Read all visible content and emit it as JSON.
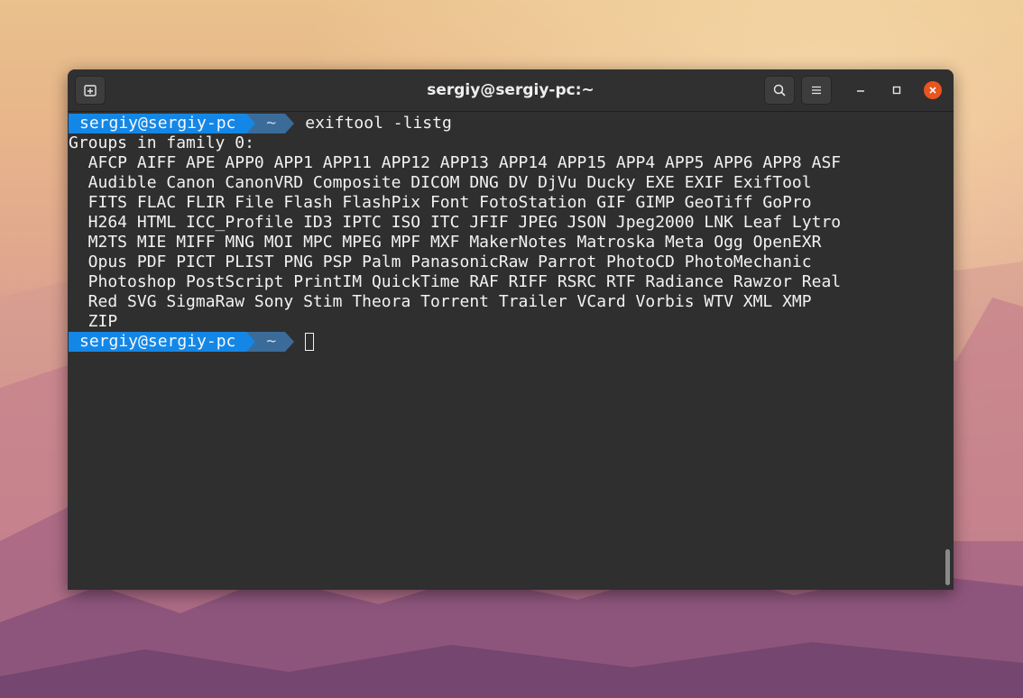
{
  "window": {
    "title": "sergiy@sergiy-pc:~",
    "new_tab_icon": "new-tab-icon",
    "search_icon": "search-icon",
    "menu_icon": "hamburger-menu-icon",
    "minimize_icon": "minimize-icon",
    "maximize_icon": "maximize-icon",
    "close_icon": "close-icon",
    "close_color": "#e9541f"
  },
  "terminal": {
    "prompt_user": "sergiy@sergiy-pc",
    "prompt_dir": "~",
    "command": "exiftool -listg",
    "header": "Groups in family 0:",
    "output_lines": [
      "  AFCP AIFF APE APP0 APP1 APP11 APP12 APP13 APP14 APP15 APP4 APP5 APP6 APP8 ASF",
      "  Audible Canon CanonVRD Composite DICOM DNG DV DjVu Ducky EXE EXIF ExifTool",
      "  FITS FLAC FLIR File Flash FlashPix Font FotoStation GIF GIMP GeoTiff GoPro",
      "  H264 HTML ICC_Profile ID3 IPTC ISO ITC JFIF JPEG JSON Jpeg2000 LNK Leaf Lytro",
      "  M2TS MIE MIFF MNG MOI MPC MPEG MPF MXF MakerNotes Matroska Meta Ogg OpenEXR",
      "  Opus PDF PICT PLIST PNG PSP Palm PanasonicRaw Parrot PhotoCD PhotoMechanic",
      "  Photoshop PostScript PrintIM QuickTime RAF RIFF RSRC RTF Radiance Rawzor Real",
      "  Red SVG SigmaRaw Sony Stim Theora Torrent Trailer VCard Vorbis WTV XML XMP",
      "  ZIP"
    ],
    "prompt_color": "#1487e6",
    "dir_color": "#3b6c99"
  }
}
